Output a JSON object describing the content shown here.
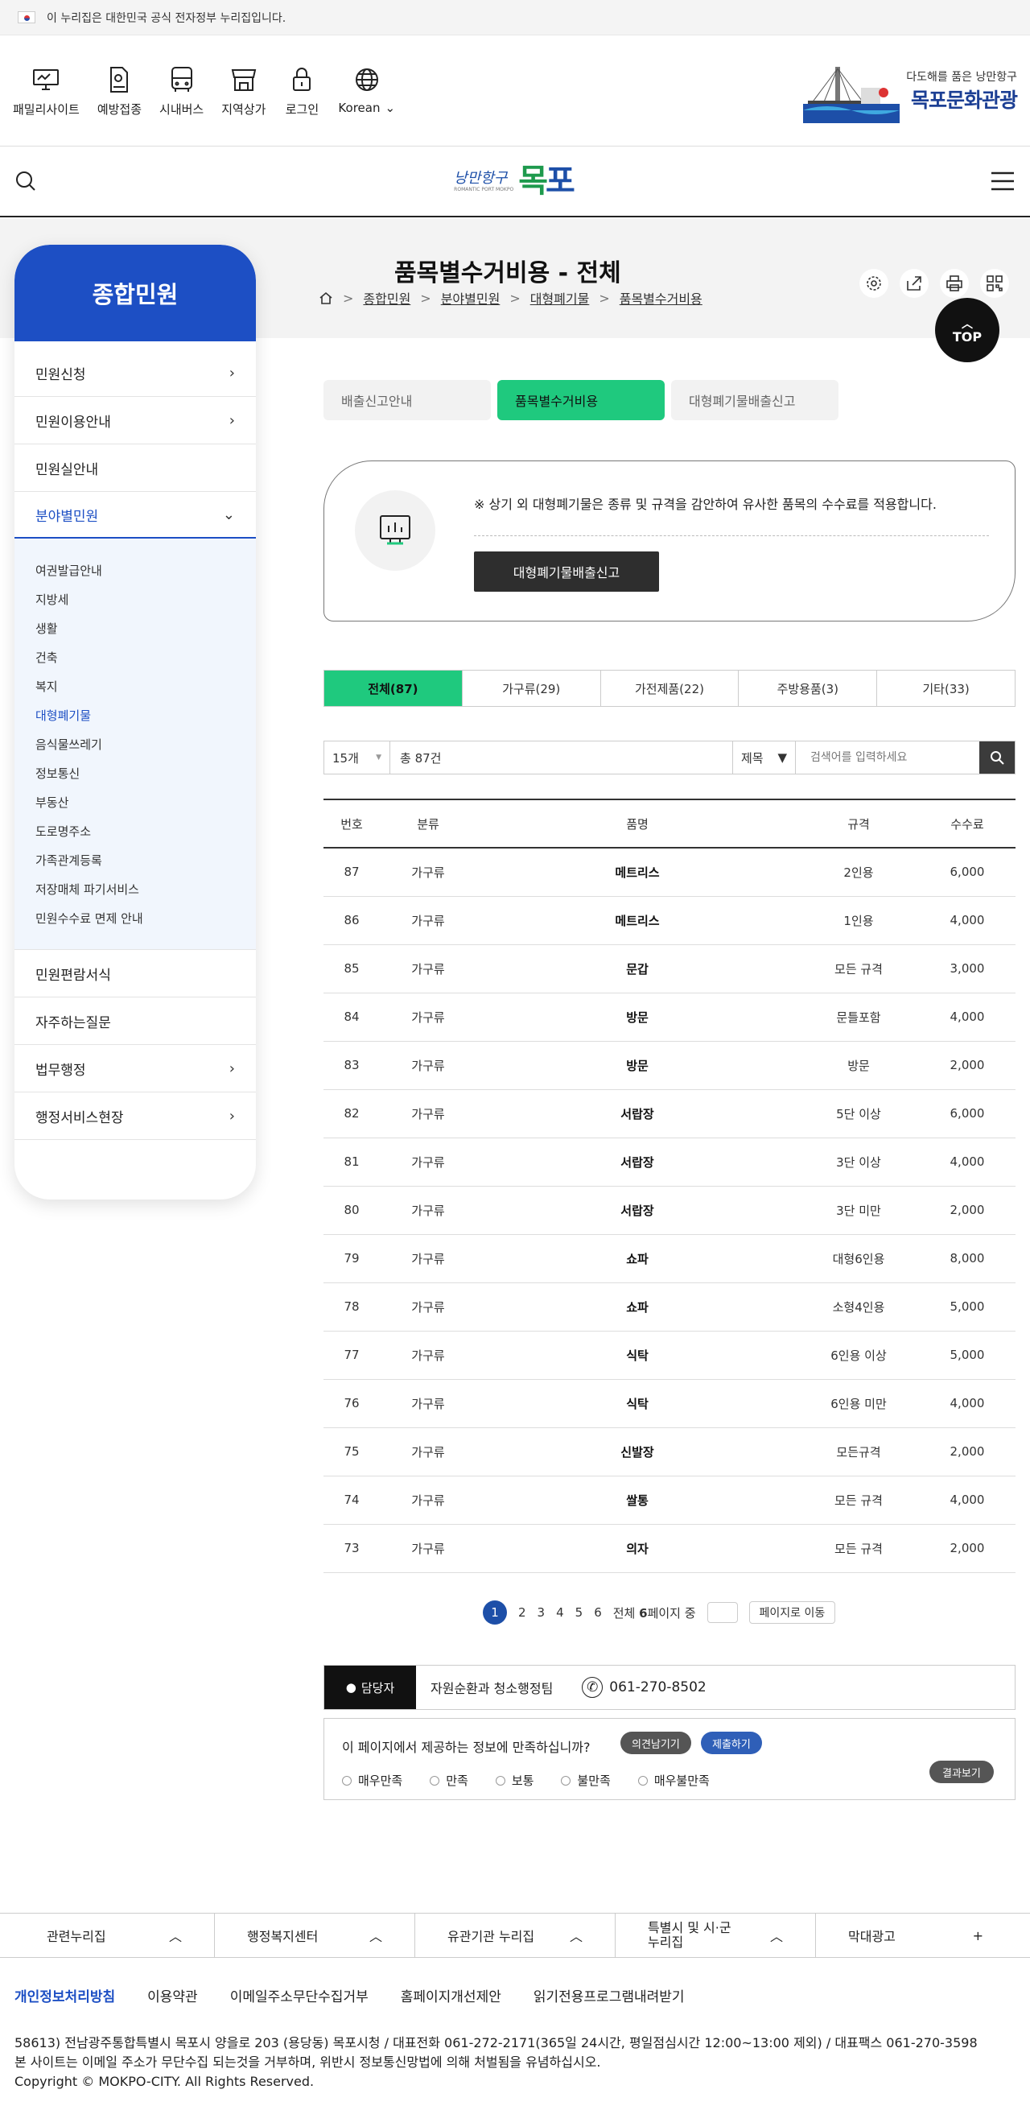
{
  "gov_banner": {
    "text": "이 누리집은 대한민국 공식 전자정부 누리집입니다."
  },
  "util": {
    "items": [
      {
        "label": "패밀리사이트",
        "icon": "monitor-icon"
      },
      {
        "label": "예방접종",
        "icon": "syringe-doc-icon"
      },
      {
        "label": "시내버스",
        "icon": "bus-icon"
      },
      {
        "label": "지역상가",
        "icon": "store-icon"
      },
      {
        "label": "로그인",
        "icon": "lock-icon"
      },
      {
        "label": "Korean",
        "icon": "globe-icon"
      }
    ],
    "promo": {
      "sub": "다도해를 품은 낭만항구",
      "title": "목포문화관광"
    }
  },
  "header": {
    "logo_small": "낭만항구",
    "logo_tag": "ROMANTIC PORT MOKPO",
    "logo_big_1": "목",
    "logo_big_2": "포"
  },
  "sidebar": {
    "title": "종합민원",
    "items": [
      {
        "label": "민원신청",
        "chev": "›"
      },
      {
        "label": "민원이용안내",
        "chev": "›"
      },
      {
        "label": "민원실안내",
        "chev": ""
      },
      {
        "label": "분야별민원",
        "chev": "⌄"
      },
      {
        "label": "민원편람서식",
        "chev": ""
      },
      {
        "label": "자주하는질문",
        "chev": ""
      },
      {
        "label": "법무행정",
        "chev": "›"
      },
      {
        "label": "행정서비스현장",
        "chev": "›"
      }
    ],
    "sub": [
      "여권발급안내",
      "지방세",
      "생활",
      "건축",
      "복지",
      "대형폐기물",
      "음식물쓰레기",
      "정보통신",
      "부동산",
      "도로명주소",
      "가족관계등록",
      "저장매체 파기서비스",
      "민원수수료 면제 안내"
    ]
  },
  "page": {
    "title": "품목별수거비용 - 전체",
    "top": "TOP"
  },
  "breadcrumb": [
    "종합민원",
    "분야별민원",
    "대형폐기물",
    "품목별수거비용"
  ],
  "tabs": [
    "배출신고안내",
    "품목별수거비용",
    "대형폐기물배출신고"
  ],
  "notice": {
    "text": "※ 상기 외 대형폐기물은 종류 및 규격을 감안하여 유사한 품목의 수수료를 적용합니다.",
    "button": "대형폐기물배출신고"
  },
  "categories": [
    "전체(87)",
    "가구류(29)",
    "가전제품(22)",
    "주방용품(3)",
    "기타(33)"
  ],
  "search": {
    "per_page": "15개",
    "total": "총 87건",
    "field": "제목",
    "placeholder": "검색어를 입력하세요"
  },
  "table": {
    "headers": [
      "번호",
      "분류",
      "품명",
      "규격",
      "수수료"
    ],
    "rows": [
      [
        "87",
        "가구류",
        "메트리스",
        "2인용",
        "6,000"
      ],
      [
        "86",
        "가구류",
        "메트리스",
        "1인용",
        "4,000"
      ],
      [
        "85",
        "가구류",
        "문갑",
        "모든 규격",
        "3,000"
      ],
      [
        "84",
        "가구류",
        "방문",
        "문틀포함",
        "4,000"
      ],
      [
        "83",
        "가구류",
        "방문",
        "방문",
        "2,000"
      ],
      [
        "82",
        "가구류",
        "서랍장",
        "5단 이상",
        "6,000"
      ],
      [
        "81",
        "가구류",
        "서랍장",
        "3단 이상",
        "4,000"
      ],
      [
        "80",
        "가구류",
        "서랍장",
        "3단 미만",
        "2,000"
      ],
      [
        "79",
        "가구류",
        "쇼파",
        "대형6인용",
        "8,000"
      ],
      [
        "78",
        "가구류",
        "쇼파",
        "소형4인용",
        "5,000"
      ],
      [
        "77",
        "가구류",
        "식탁",
        "6인용 이상",
        "5,000"
      ],
      [
        "76",
        "가구류",
        "식탁",
        "6인용 미만",
        "4,000"
      ],
      [
        "75",
        "가구류",
        "신발장",
        "모든규격",
        "2,000"
      ],
      [
        "74",
        "가구류",
        "쌀통",
        "모든 규격",
        "4,000"
      ],
      [
        "73",
        "가구류",
        "의자",
        "모든 규격",
        "2,000"
      ]
    ]
  },
  "pager": {
    "pages": [
      "1",
      "2",
      "3",
      "4",
      "5",
      "6"
    ],
    "total_prefix": "전체",
    "total_num": "6",
    "total_suffix": "페이지 중",
    "go": "페이지로 이동"
  },
  "manager": {
    "tag": "담당자",
    "dept": "자원순환과 청소행정팀",
    "phone": "061-270-8502"
  },
  "survey": {
    "question": "이 페이지에서 제공하는 정보에 만족하십니까?",
    "opinion": "의견남기기",
    "submit": "제출하기",
    "options": [
      "매우만족",
      "만족",
      "보통",
      "불만족",
      "매우불만족"
    ],
    "result": "결과보기"
  },
  "footer": {
    "sites": [
      "관련누리집",
      "행정복지센터",
      "유관기관 누리집",
      "특별시 및 시·군 누리집",
      "막대광고"
    ],
    "links": [
      "개인정보처리방침",
      "이용약관",
      "이메일주소무단수집거부",
      "홈페이지개선제안",
      "읽기전용프로그램내려받기"
    ],
    "addr1": "58613) 전남광주통합특별시 목포시 양을로 203 (용당동) 목포시청 / 대표전화 061-272-2171(365일 24시간, 평일점심시간 12:00~13:00 제외) / 대표팩스 061-270-3598",
    "addr2": "본 사이트는 이메일 주소가 무단수집 되는것을 거부하며, 위반시 정보통신망법에 의해 처벌됨을 유념하십시오.",
    "copy": "Copyright © MOKPO-CITY. All Rights Reserved."
  },
  "colors": {
    "accent_green": "#1fc97e",
    "brand_blue": "#1d4fc4"
  }
}
